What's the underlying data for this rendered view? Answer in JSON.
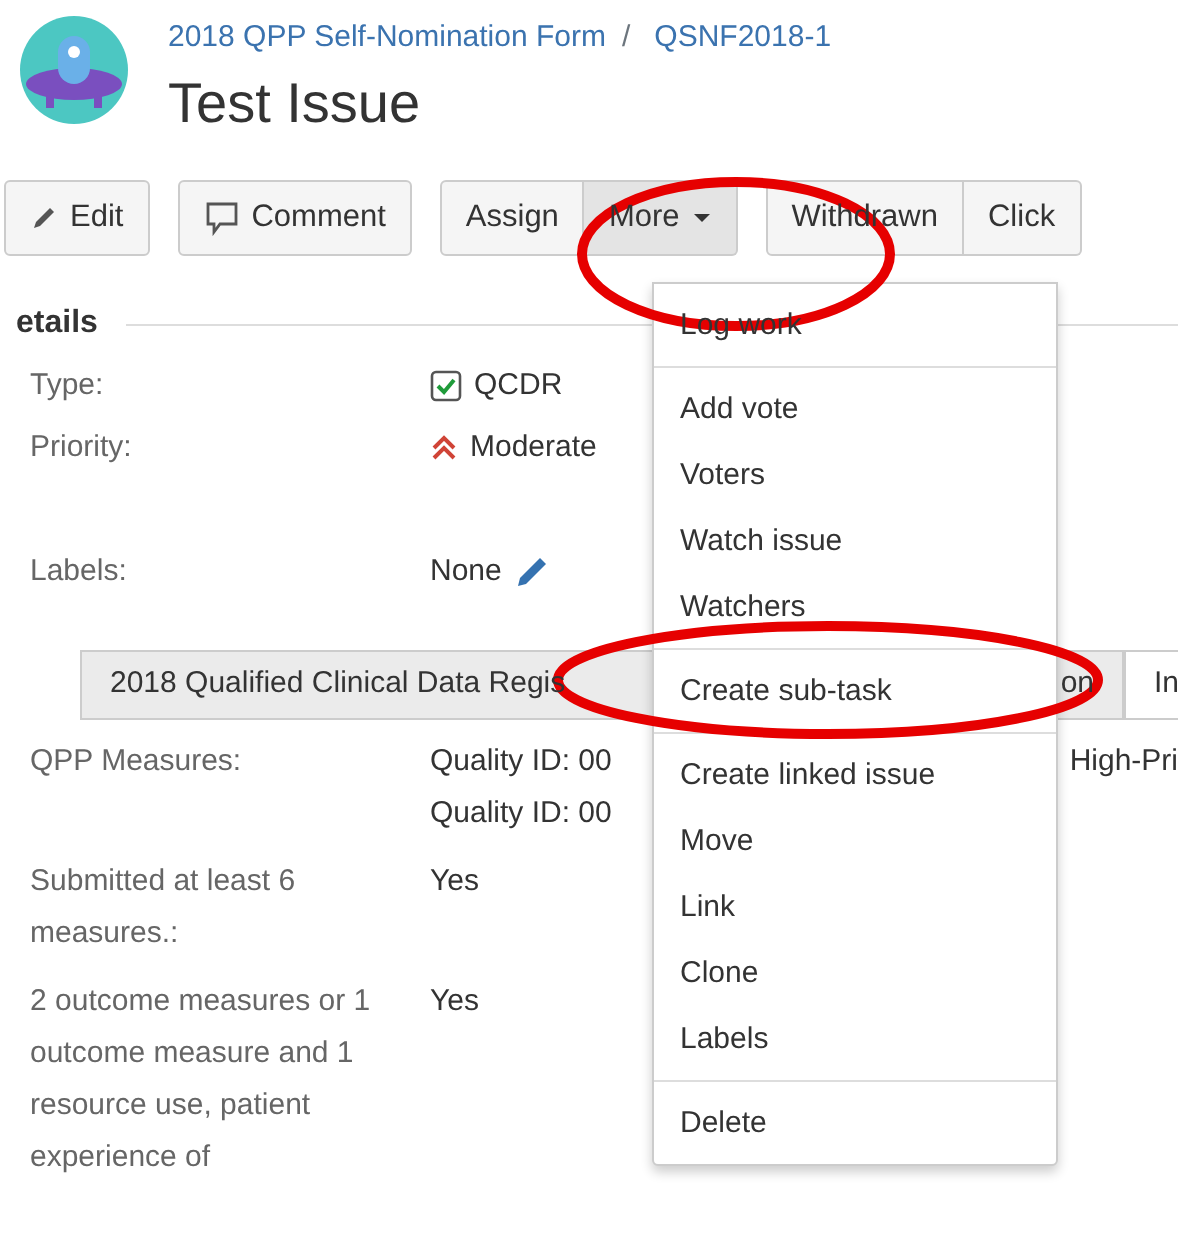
{
  "breadcrumb": {
    "project": "2018 QPP Self-Nomination Form",
    "separator": "/",
    "issue_key": "QSNF2018-1"
  },
  "title": "Test Issue",
  "toolbar": [
    {
      "buttons": [
        {
          "kind": "edit",
          "label": "Edit",
          "expanded": false
        }
      ]
    },
    {
      "buttons": [
        {
          "kind": "comment",
          "label": "Comment",
          "expanded": false
        }
      ]
    },
    {
      "buttons": [
        {
          "kind": "plain",
          "label": "Assign",
          "expanded": false
        },
        {
          "kind": "dropdown",
          "label": "More",
          "expanded": true
        }
      ]
    },
    {
      "buttons": [
        {
          "kind": "plain",
          "label": "Withdrawn",
          "expanded": false
        },
        {
          "kind": "plain",
          "label": "Click",
          "expanded": false
        }
      ]
    }
  ],
  "section_heading": "etails",
  "fields": [
    {
      "kind": "type",
      "label": "Type:",
      "value": "QCDR"
    },
    {
      "kind": "priority",
      "label": "Priority:",
      "value": "Moderate"
    },
    {
      "kind": "labels",
      "label": "Labels:",
      "value": "None"
    }
  ],
  "tabs": [
    {
      "label_start": "2018 Qualified Clinical Data Regis",
      "label_end": "on",
      "selected": false
    },
    {
      "label_start": "In",
      "selected": true
    }
  ],
  "details": [
    {
      "label": "QPP Measures:",
      "lines": [
        [
          "Quality ID: 00",
          "High-Pri"
        ],
        [
          "Quality ID: 00"
        ]
      ]
    },
    {
      "label": "Submitted at least 6 measures.:",
      "lines": [
        [
          "Yes"
        ]
      ]
    },
    {
      "label": "2 outcome measures or 1 outcome measure and 1 resource use, patient experience of",
      "lines": [
        [
          "Yes"
        ]
      ]
    }
  ],
  "menu": {
    "groups": [
      [
        "Log work"
      ],
      [
        "Add vote",
        "Voters",
        "Watch issue",
        "Watchers"
      ],
      [
        "Create sub-task"
      ],
      [
        "Create linked issue",
        "Move",
        "Link",
        "Clone",
        "Labels"
      ],
      [
        "Delete"
      ]
    ]
  },
  "annotations": [
    {
      "kind": "ellipse"
    },
    {
      "kind": "ellipse"
    }
  ]
}
